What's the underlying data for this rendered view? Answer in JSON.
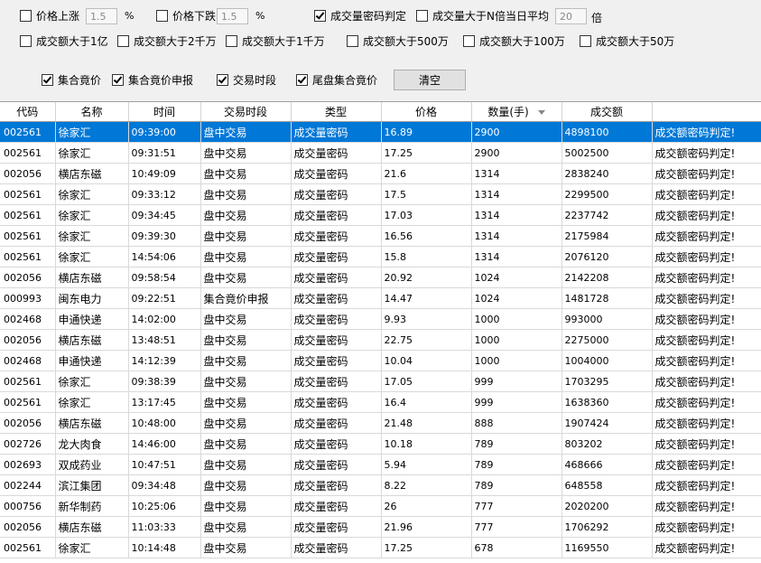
{
  "filters": {
    "row1": {
      "price_up": {
        "label": "价格上涨",
        "value": "1.5",
        "unit": "%",
        "checked": false
      },
      "price_down": {
        "label": "价格下跌",
        "value": "1.5",
        "unit": "%",
        "checked": false
      },
      "volume_code": {
        "label": "成交量密码判定",
        "checked": true
      },
      "volume_times": {
        "label": "成交量大于N倍当日平均",
        "value": "20",
        "unit": "倍",
        "checked": false
      }
    },
    "row2": [
      {
        "label": "成交额大于1亿",
        "checked": false
      },
      {
        "label": "成交额大于2千万",
        "checked": false
      },
      {
        "label": "成交额大于1千万",
        "checked": false
      },
      {
        "label": "成交额大于500万",
        "checked": false
      },
      {
        "label": "成交额大于100万",
        "checked": false
      },
      {
        "label": "成交额大于50万",
        "checked": false
      }
    ],
    "row3": [
      {
        "label": "集合竟价",
        "checked": true
      },
      {
        "label": "集合竟价申报",
        "checked": true
      },
      {
        "label": "交易时段",
        "checked": true
      },
      {
        "label": "尾盘集合竟价",
        "checked": true
      }
    ],
    "clear_label": "清空"
  },
  "table": {
    "columns": [
      "代码",
      "名称",
      "时间",
      "交易时段",
      "类型",
      "价格",
      "数量(手)",
      "成交额",
      ""
    ],
    "rows": [
      [
        "002561",
        "徐家汇",
        "09:39:00",
        "盘中交易",
        "成交量密码",
        "16.89",
        "2900",
        "4898100",
        "成交额密码判定!"
      ],
      [
        "002561",
        "徐家汇",
        "09:31:51",
        "盘中交易",
        "成交量密码",
        "17.25",
        "2900",
        "5002500",
        "成交额密码判定!"
      ],
      [
        "002056",
        "横店东磁",
        "10:49:09",
        "盘中交易",
        "成交量密码",
        "21.6",
        "1314",
        "2838240",
        "成交额密码判定!"
      ],
      [
        "002561",
        "徐家汇",
        "09:33:12",
        "盘中交易",
        "成交量密码",
        "17.5",
        "1314",
        "2299500",
        "成交额密码判定!"
      ],
      [
        "002561",
        "徐家汇",
        "09:34:45",
        "盘中交易",
        "成交量密码",
        "17.03",
        "1314",
        "2237742",
        "成交额密码判定!"
      ],
      [
        "002561",
        "徐家汇",
        "09:39:30",
        "盘中交易",
        "成交量密码",
        "16.56",
        "1314",
        "2175984",
        "成交额密码判定!"
      ],
      [
        "002561",
        "徐家汇",
        "14:54:06",
        "盘中交易",
        "成交量密码",
        "15.8",
        "1314",
        "2076120",
        "成交额密码判定!"
      ],
      [
        "002056",
        "横店东磁",
        "09:58:54",
        "盘中交易",
        "成交量密码",
        "20.92",
        "1024",
        "2142208",
        "成交额密码判定!"
      ],
      [
        "000993",
        "闽东电力",
        "09:22:51",
        "集合竟价申报",
        "成交量密码",
        "14.47",
        "1024",
        "1481728",
        "成交额密码判定!"
      ],
      [
        "002468",
        "申通快递",
        "14:02:00",
        "盘中交易",
        "成交量密码",
        "9.93",
        "1000",
        "993000",
        "成交额密码判定!"
      ],
      [
        "002056",
        "横店东磁",
        "13:48:51",
        "盘中交易",
        "成交量密码",
        "22.75",
        "1000",
        "2275000",
        "成交额密码判定!"
      ],
      [
        "002468",
        "申通快递",
        "14:12:39",
        "盘中交易",
        "成交量密码",
        "10.04",
        "1000",
        "1004000",
        "成交额密码判定!"
      ],
      [
        "002561",
        "徐家汇",
        "09:38:39",
        "盘中交易",
        "成交量密码",
        "17.05",
        "999",
        "1703295",
        "成交额密码判定!"
      ],
      [
        "002561",
        "徐家汇",
        "13:17:45",
        "盘中交易",
        "成交量密码",
        "16.4",
        "999",
        "1638360",
        "成交额密码判定!"
      ],
      [
        "002056",
        "横店东磁",
        "10:48:00",
        "盘中交易",
        "成交量密码",
        "21.48",
        "888",
        "1907424",
        "成交额密码判定!"
      ],
      [
        "002726",
        "龙大肉食",
        "14:46:00",
        "盘中交易",
        "成交量密码",
        "10.18",
        "789",
        "803202",
        "成交额密码判定!"
      ],
      [
        "002693",
        "双成药业",
        "10:47:51",
        "盘中交易",
        "成交量密码",
        "5.94",
        "789",
        "468666",
        "成交额密码判定!"
      ],
      [
        "002244",
        "滨江集团",
        "09:34:48",
        "盘中交易",
        "成交量密码",
        "8.22",
        "789",
        "648558",
        "成交额密码判定!"
      ],
      [
        "000756",
        "新华制药",
        "10:25:06",
        "盘中交易",
        "成交量密码",
        "26",
        "777",
        "2020200",
        "成交额密码判定!"
      ],
      [
        "002056",
        "横店东磁",
        "11:03:33",
        "盘中交易",
        "成交量密码",
        "21.96",
        "777",
        "1706292",
        "成交额密码判定!"
      ],
      [
        "002561",
        "徐家汇",
        "10:14:48",
        "盘中交易",
        "成交量密码",
        "17.25",
        "678",
        "1169550",
        "成交额密码判定!"
      ]
    ],
    "selected_row": 0
  }
}
